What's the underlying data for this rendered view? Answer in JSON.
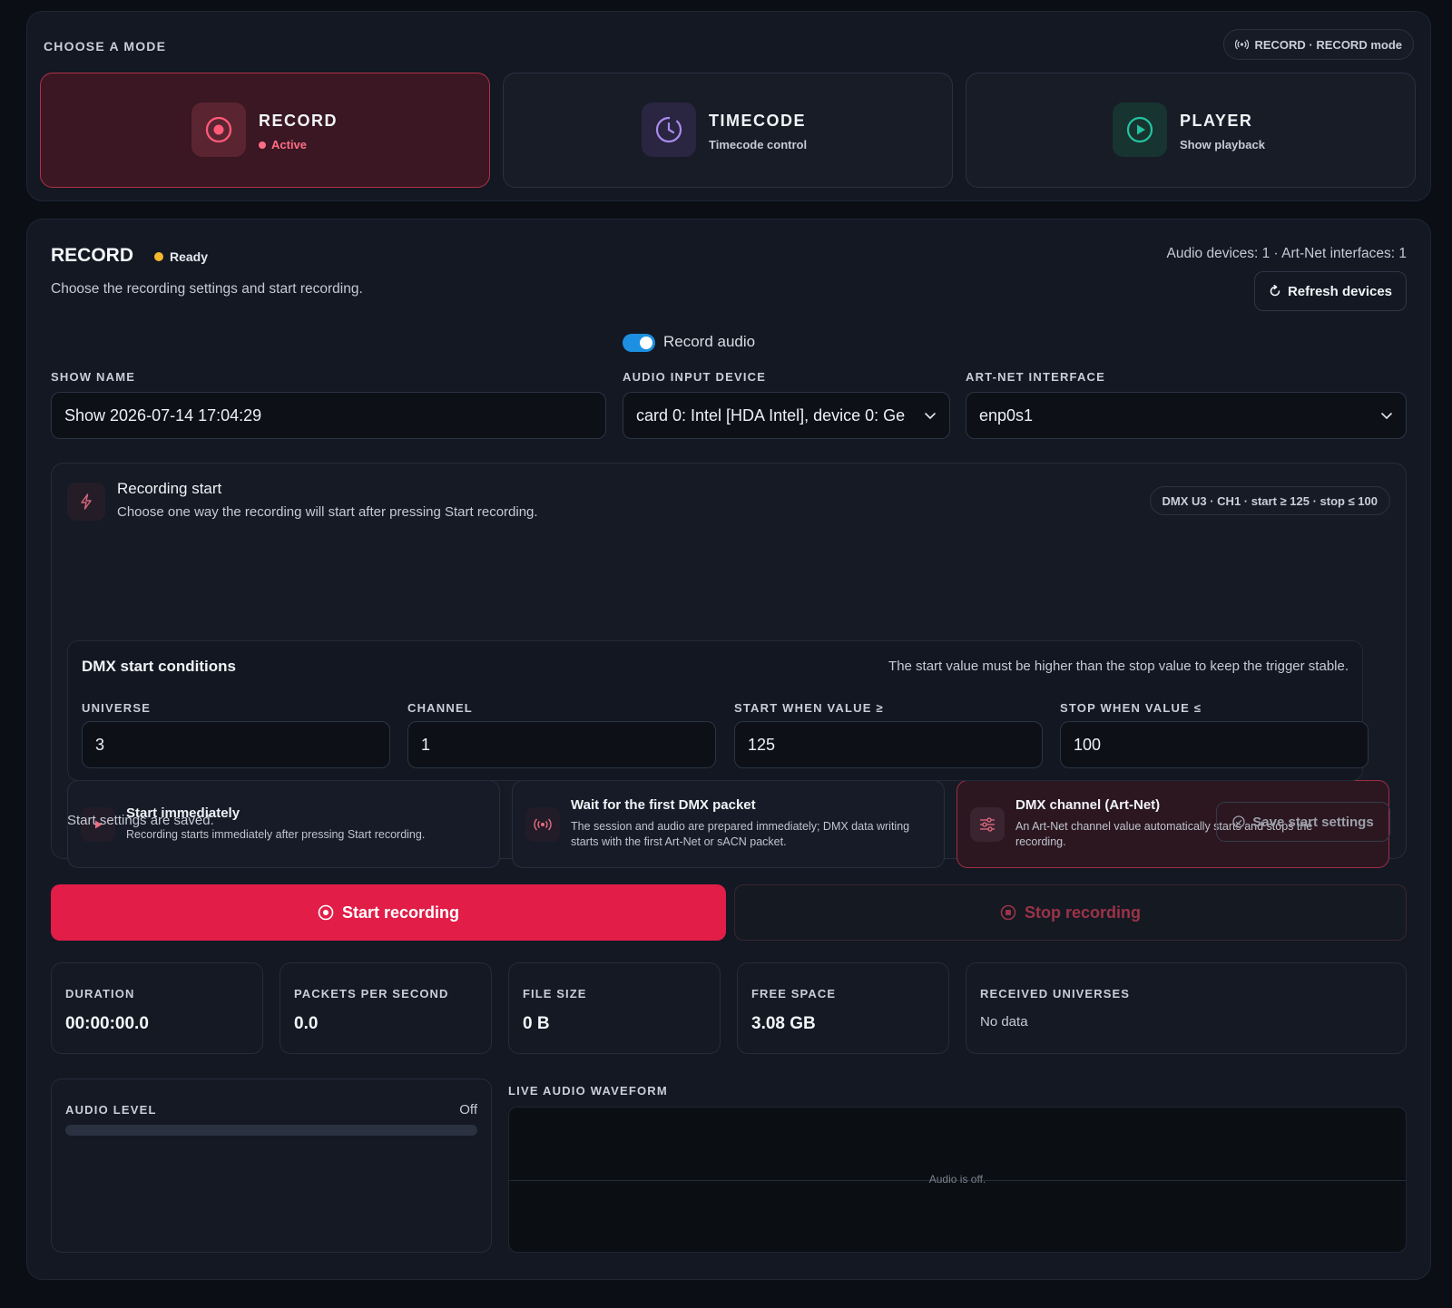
{
  "mode_panel": {
    "title": "CHOOSE A MODE",
    "status_pill": "RECORD · RECORD mode",
    "modes": [
      {
        "title": "RECORD",
        "subtitle": "Active",
        "icon": "record-icon"
      },
      {
        "title": "TIMECODE",
        "subtitle": "Timecode control",
        "icon": "clock-icon"
      },
      {
        "title": "PLAYER",
        "subtitle": "Show playback",
        "icon": "play-icon"
      }
    ]
  },
  "record": {
    "title": "RECORD",
    "status": "Ready",
    "description": "Choose the recording settings and start recording.",
    "device_summary": "Audio devices: 1 · Art-Net interfaces: 1",
    "refresh_label": "Refresh devices",
    "record_audio_label": "Record audio",
    "record_audio_enabled": true,
    "show_name_label": "SHOW NAME",
    "show_name_value": "Show 2026-07-14 17:04:29",
    "audio_input_label": "AUDIO INPUT DEVICE",
    "audio_input_value": "card 0: Intel [HDA Intel], device 0: Ge",
    "artnet_label": "ART-NET INTERFACE",
    "artnet_value": "enp0s1"
  },
  "recording_start": {
    "title": "Recording start",
    "description": "Choose one way the recording will start after pressing Start recording.",
    "summary_pill": "DMX U3 · CH1 · start ≥ 125 · stop ≤ 100",
    "options": [
      {
        "title": "Start immediately",
        "description": "Recording starts immediately after pressing Start recording.",
        "icon": "play-icon"
      },
      {
        "title": "Wait for the first DMX packet",
        "description": "The session and audio are prepared immediately; DMX data writing starts with the first Art-Net or sACN packet.",
        "icon": "broadcast-icon"
      },
      {
        "title": "DMX channel (Art-Net)",
        "description": "An Art-Net channel value automatically starts and stops the recording.",
        "icon": "sliders-icon"
      }
    ],
    "conditions": {
      "title": "DMX start conditions",
      "hint": "The start value must be higher than the stop value to keep the trigger stable.",
      "universe_label": "UNIVERSE",
      "universe_value": "3",
      "channel_label": "CHANNEL",
      "channel_value": "1",
      "start_label": "START WHEN VALUE ≥",
      "start_value": "125",
      "stop_label": "STOP WHEN VALUE ≤",
      "stop_value": "100"
    },
    "saved_status": "Start settings are saved.",
    "save_label": "Save start settings"
  },
  "controls": {
    "start_label": "Start recording",
    "stop_label": "Stop recording"
  },
  "stats": {
    "duration_label": "DURATION",
    "duration_value": "00:00:00.0",
    "pps_label": "PACKETS PER SECOND",
    "pps_value": "0.0",
    "filesize_label": "FILE SIZE",
    "filesize_value": "0 B",
    "freespace_label": "FREE SPACE",
    "freespace_value": "3.08 GB",
    "universes_label": "RECEIVED UNIVERSES",
    "universes_value": "No data"
  },
  "audio": {
    "level_label": "AUDIO LEVEL",
    "level_state": "Off",
    "level_fraction": 0,
    "waveform_label": "LIVE AUDIO WAVEFORM",
    "waveform_message": "Audio is off."
  },
  "colors": {
    "accent_red": "#e11d48",
    "active_border": "#b03249",
    "toggle_blue": "#1d8fe0",
    "ready_yellow": "#f5b82e",
    "player_green": "#23c2a0",
    "timecode_purple": "#a98bf0"
  }
}
